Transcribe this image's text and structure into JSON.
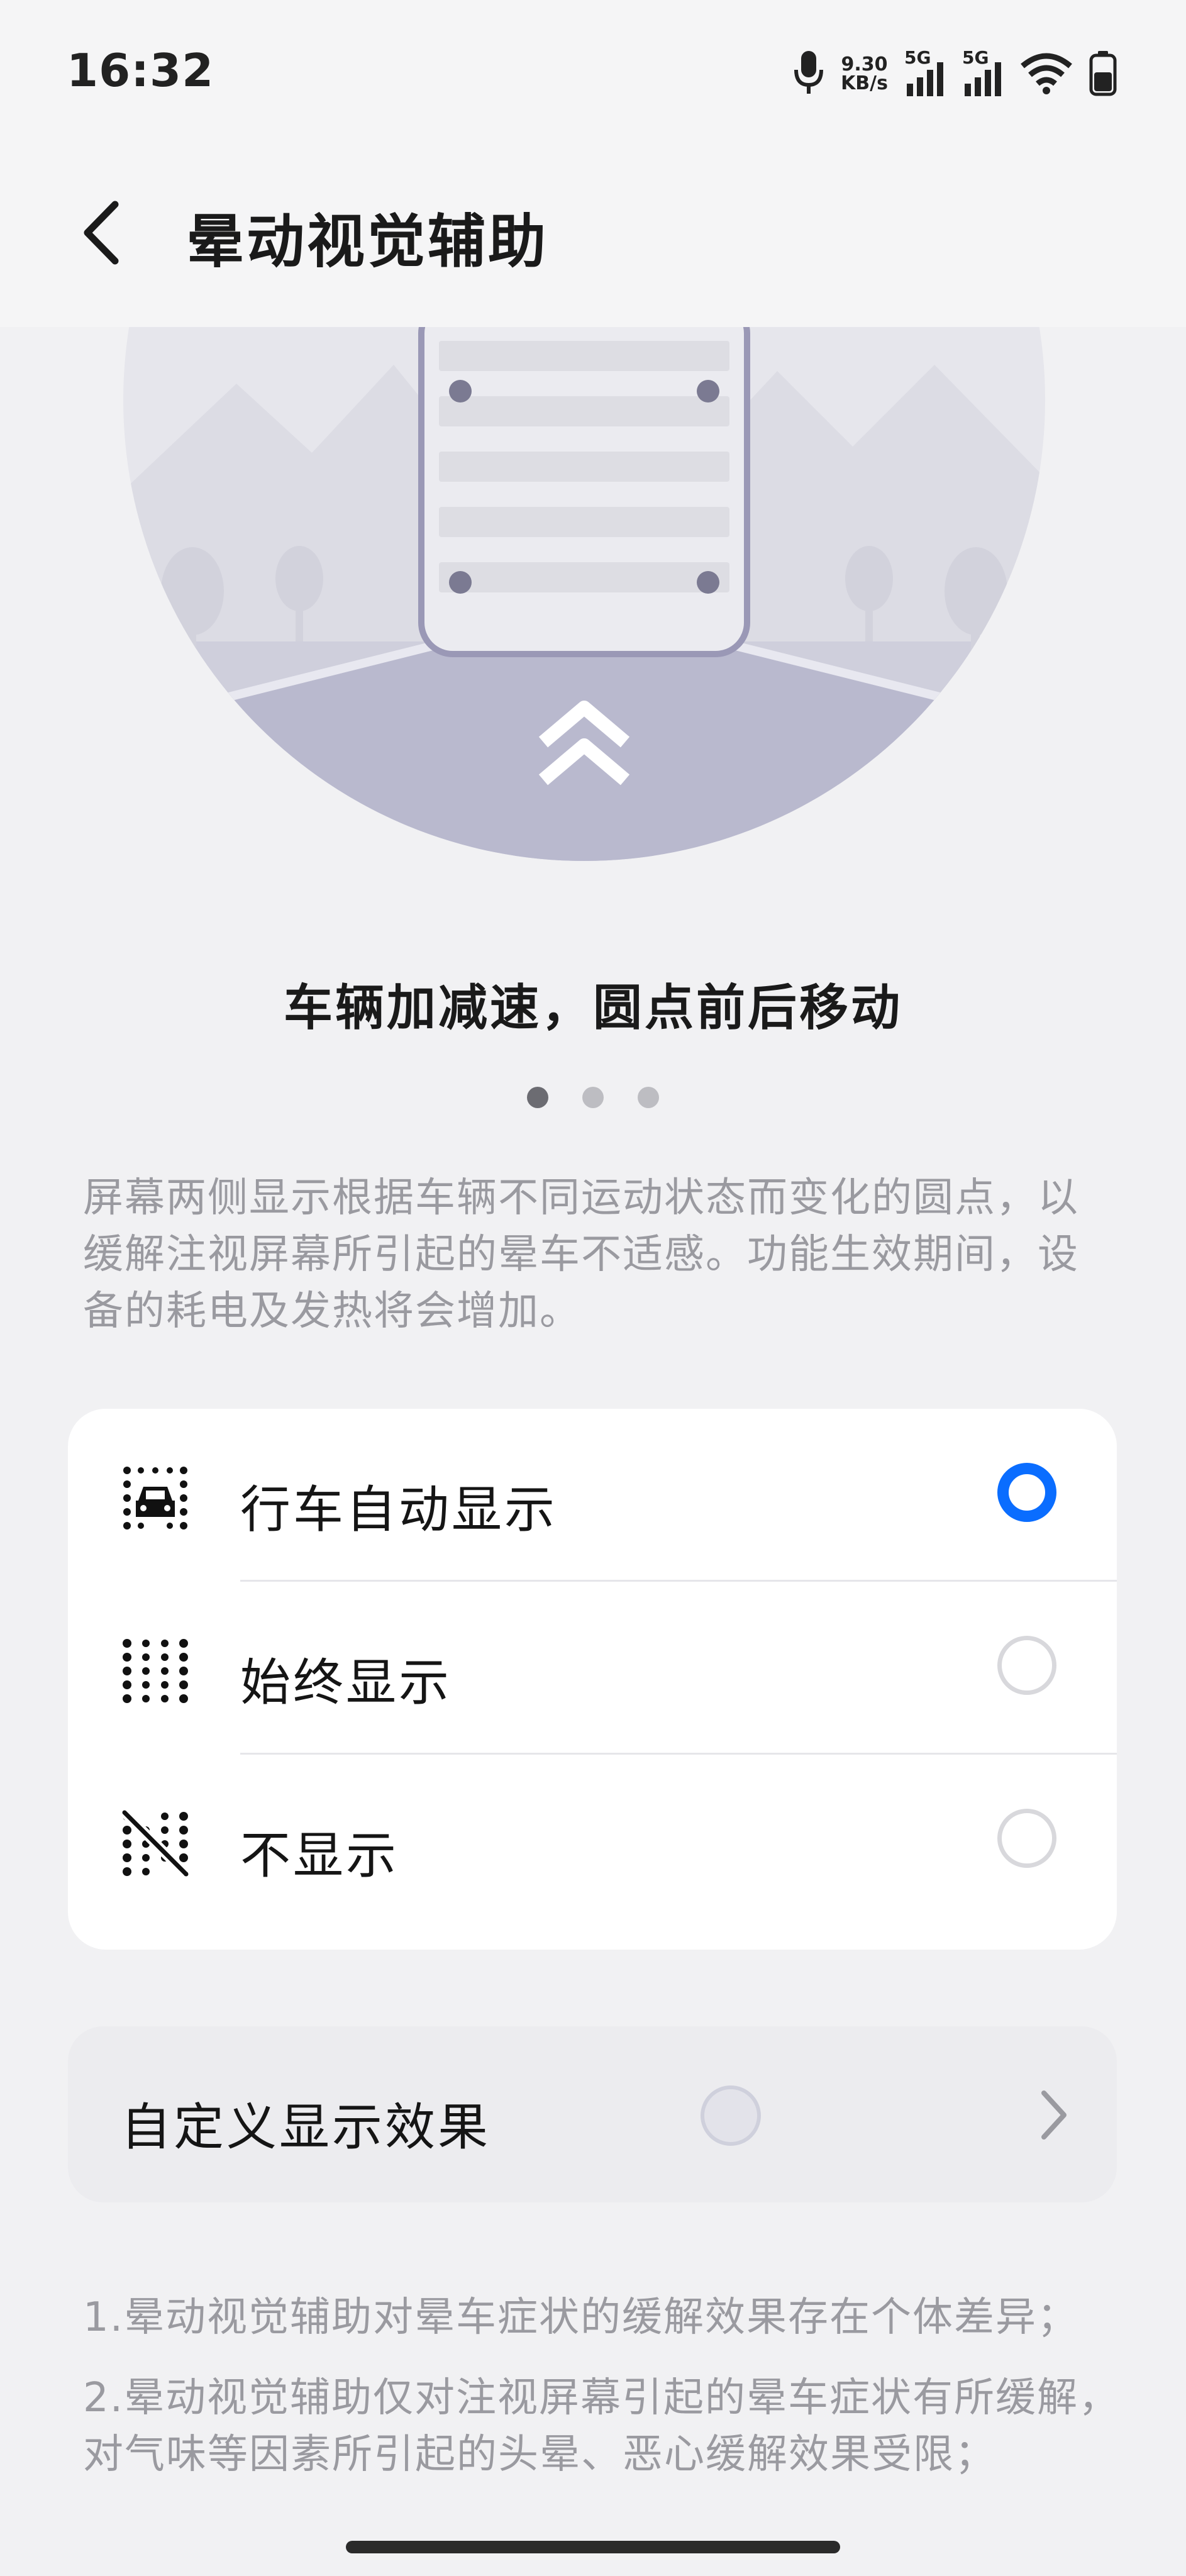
{
  "status_bar": {
    "time": "16:32",
    "net_speed_value": "9.30",
    "net_speed_unit": "KB/s",
    "sim1_label": "5G",
    "sim2_label": "5G",
    "icons": [
      "microphone-icon",
      "signal-icon",
      "signal-icon",
      "wifi-icon",
      "battery-icon"
    ]
  },
  "header": {
    "title": "晕动视觉辅助",
    "back_icon": "chevron-left-icon"
  },
  "illustration": {
    "caption": "车辆加减速，圆点前后移动",
    "pager": {
      "count": 3,
      "active_index": 0
    }
  },
  "description": "屏幕两侧显示根据车辆不同运动状态而变化的圆点，以缓解注视屏幕所引起的晕车不适感。功能生效期间，设备的耗电及发热将会增加。",
  "options": [
    {
      "label": "行车自动显示",
      "icon": "car-dots-icon",
      "checked": true
    },
    {
      "label": "始终显示",
      "icon": "dots-grid-icon",
      "checked": false
    },
    {
      "label": "不显示",
      "icon": "dots-off-icon",
      "checked": false
    }
  ],
  "custom": {
    "label": "自定义显示效果",
    "icon": "chevron-right-icon"
  },
  "notes": [
    "1.晕动视觉辅助对晕车症状的缓解效果存在个体差异；",
    "2.晕动视觉辅助仅对注视屏幕引起的晕车症状有所缓解，对气味等因素所引起的头晕、恶心缓解效果受限；"
  ],
  "colors": {
    "accent": "#0a6dff",
    "background": "#f1f1f3",
    "card": "#ffffff",
    "secondary_text": "#9a9aa0"
  }
}
